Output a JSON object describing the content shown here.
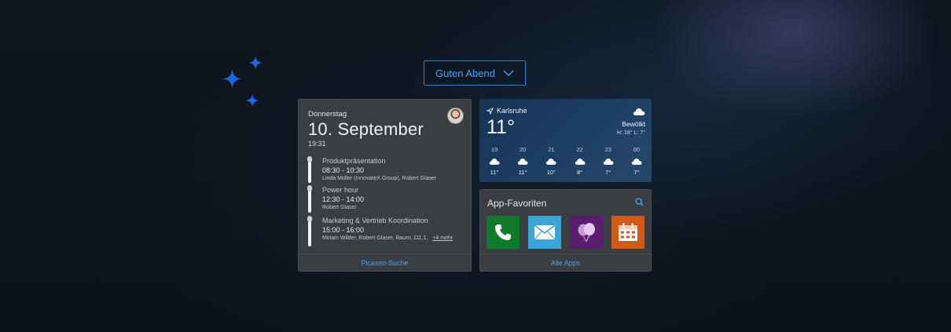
{
  "greeting": {
    "label": "Guten Abend"
  },
  "calendar": {
    "weekday": "Donnerstag",
    "date": "10. September",
    "time": "19:31",
    "events": [
      {
        "title": "Produktpräsentation",
        "hours": "08:30 - 10:30",
        "people": "Linda Müller (InnovateX Group), Robert Glaser",
        "more": ""
      },
      {
        "title": "Power hour",
        "hours": "12:30 - 14:00",
        "people": "Robert Glaser",
        "more": ""
      },
      {
        "title": "Marketing & Vertrieb Koordination",
        "hours": "15:00 - 16:00",
        "people": "Miriam Wilder, Robert Glaser, Raum: 111,1,",
        "more": "+4 mehr"
      }
    ],
    "footer": "Picasso-Suche"
  },
  "weather": {
    "location": "Karlsruhe",
    "temperature": "11°",
    "condition": "Bewölkt",
    "high_low": "H: 18° L: 7°",
    "forecast": [
      {
        "hour": "19",
        "temp": "11°"
      },
      {
        "hour": "20",
        "temp": "11°"
      },
      {
        "hour": "21",
        "temp": "10°"
      },
      {
        "hour": "22",
        "temp": "8°"
      },
      {
        "hour": "23",
        "temp": "7°"
      },
      {
        "hour": "00",
        "temp": "7°"
      }
    ]
  },
  "apps": {
    "title": "App-Favoriten",
    "tiles": [
      {
        "icon": "phone-icon",
        "color": "#0f7a2a"
      },
      {
        "icon": "mail-icon",
        "color": "#3aa6d6"
      },
      {
        "icon": "balloons-icon",
        "color": "#5a1e6e"
      },
      {
        "icon": "calendar-icon",
        "color": "#d35a16"
      }
    ],
    "footer": "Alle Apps"
  },
  "colors": {
    "accent": "#49a3f0",
    "sparkle": "#1f64e0",
    "card": "#3a3d41"
  }
}
